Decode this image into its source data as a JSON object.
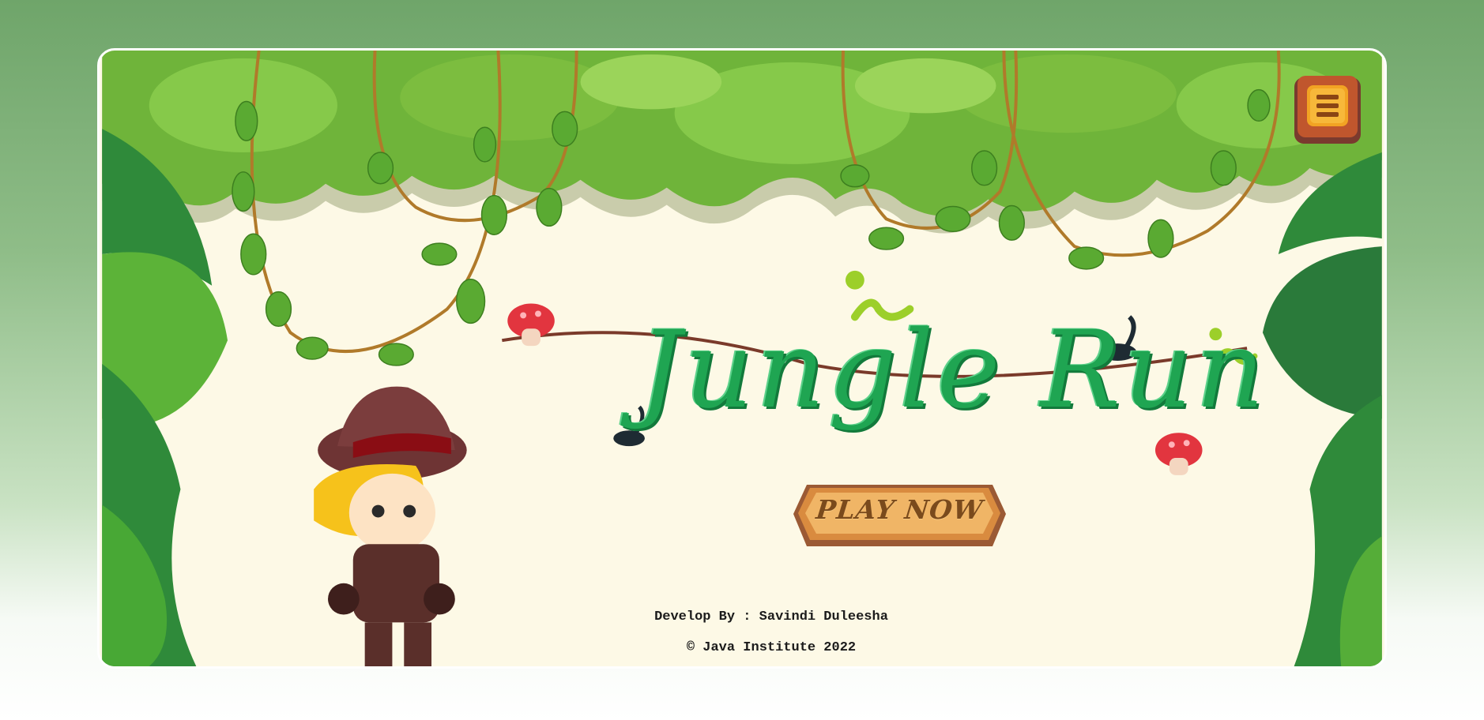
{
  "game": {
    "title": "Jungle Run",
    "play_label": "PLAY NOW",
    "menu_icon": "menu-icon"
  },
  "footer": {
    "developer": "Develop By : Savindi Duleesha",
    "copyright": "© Java Institute 2022"
  },
  "colors": {
    "page_top": "#6fa56a",
    "canvas": "#fdf9e6",
    "foliage": "#6fb43a",
    "title_green": "#1fa552",
    "button_wood": "#d98b3f"
  }
}
